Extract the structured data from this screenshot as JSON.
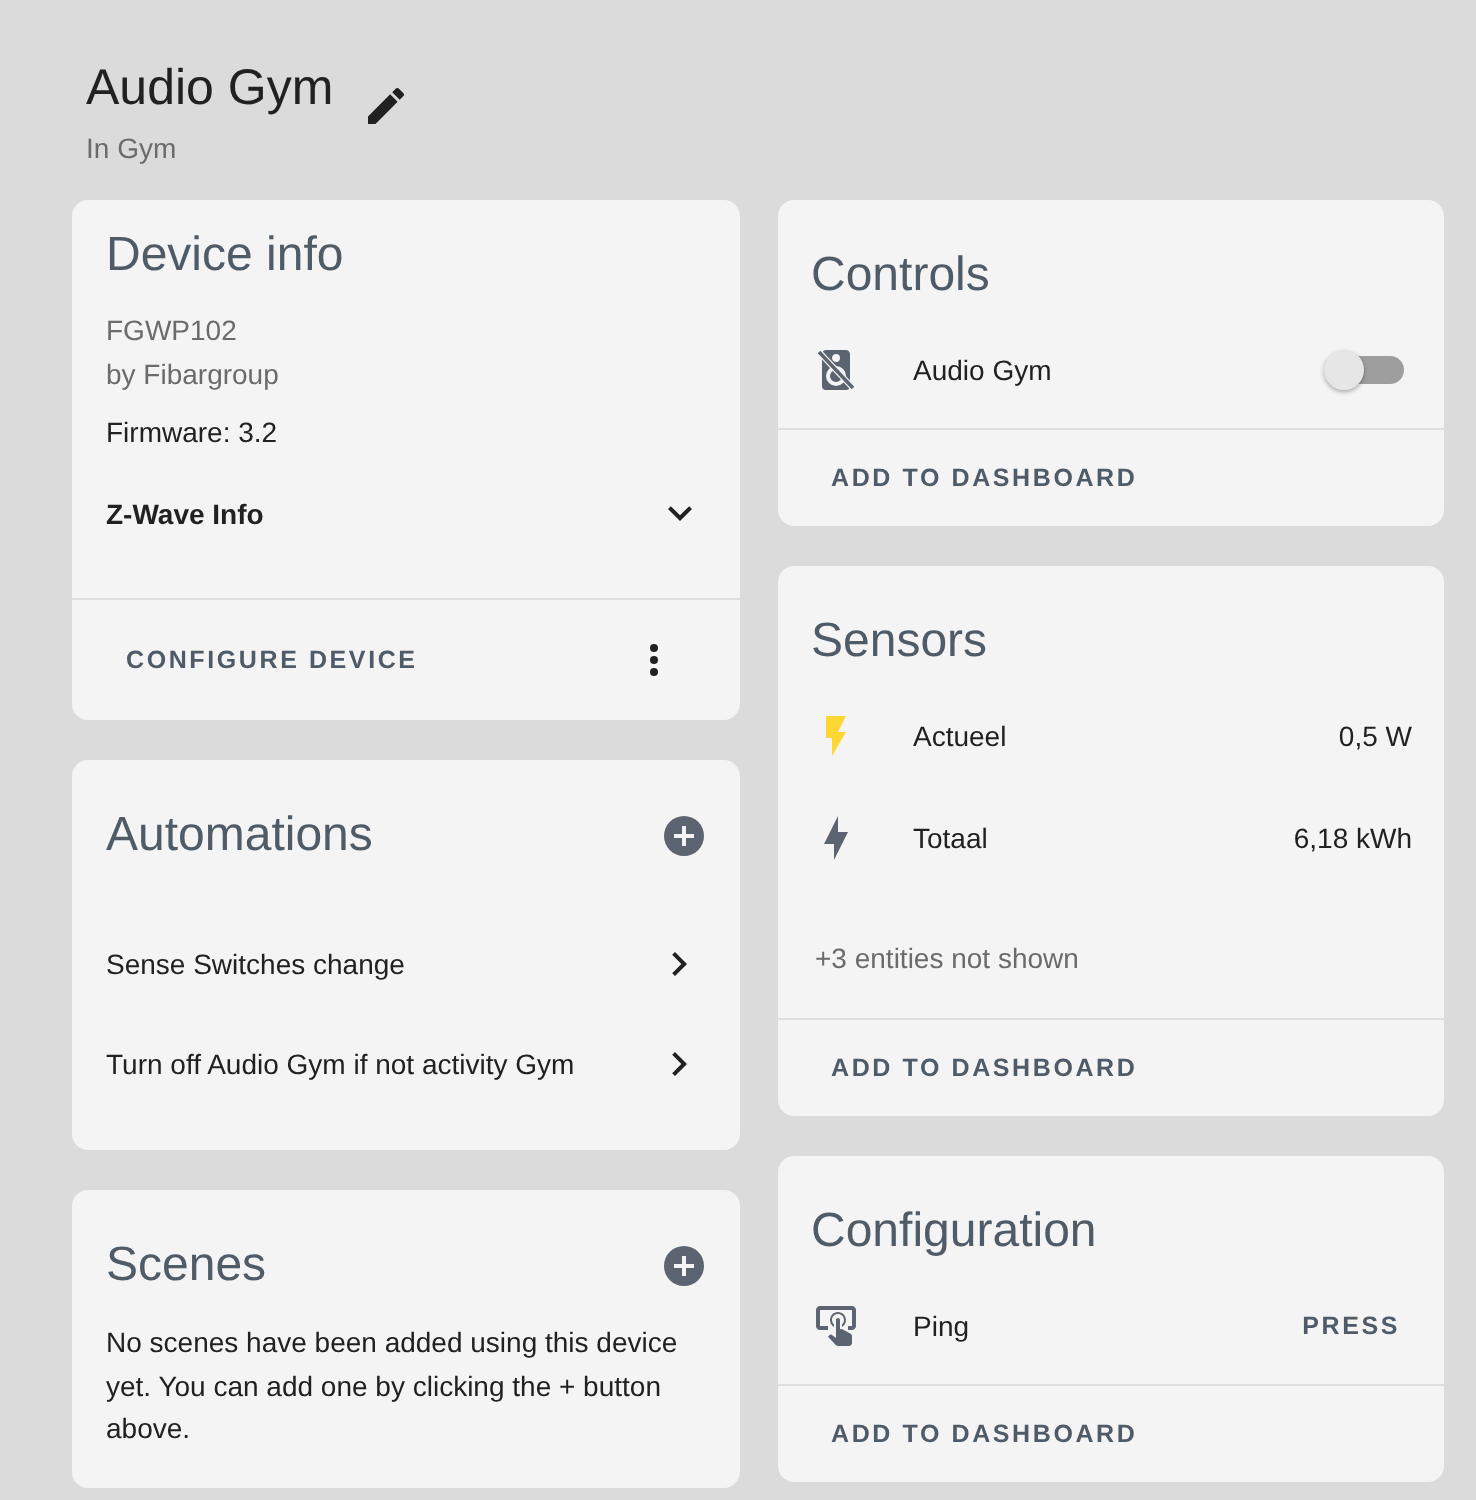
{
  "header": {
    "title": "Audio Gym",
    "area": "In Gym"
  },
  "device_info": {
    "title": "Device info",
    "model": "FGWP102",
    "manufacturer": "by Fibargroup",
    "firmware": "Firmware: 3.2",
    "zwave_info": {
      "label": "Z-Wave Info",
      "expanded": false
    },
    "action": "CONFIGURE DEVICE"
  },
  "automations": {
    "title": "Automations",
    "items": [
      "Sense Switches change",
      "Turn off Audio Gym if not activity Gym"
    ]
  },
  "scenes": {
    "title": "Scenes",
    "empty_text": "No scenes have been added using this device yet. You can add one by clicking the + button above."
  },
  "controls": {
    "title": "Controls",
    "entities": [
      {
        "kind": "switch",
        "name": "Audio Gym",
        "on": false
      }
    ],
    "action": "ADD TO DASHBOARD"
  },
  "sensors": {
    "title": "Sensors",
    "entities": [
      {
        "kind": "power",
        "name": "Actueel",
        "value": "0,5 W",
        "color": "#fdd835"
      },
      {
        "kind": "energy",
        "name": "Totaal",
        "value": "6,18 kWh",
        "color": "#5b6470"
      }
    ],
    "hidden_note": "+3 entities not shown",
    "action": "ADD TO DASHBOARD"
  },
  "configuration": {
    "title": "Configuration",
    "entities": [
      {
        "kind": "button",
        "name": "Ping",
        "action": "PRESS"
      }
    ],
    "action": "ADD TO DASHBOARD"
  }
}
